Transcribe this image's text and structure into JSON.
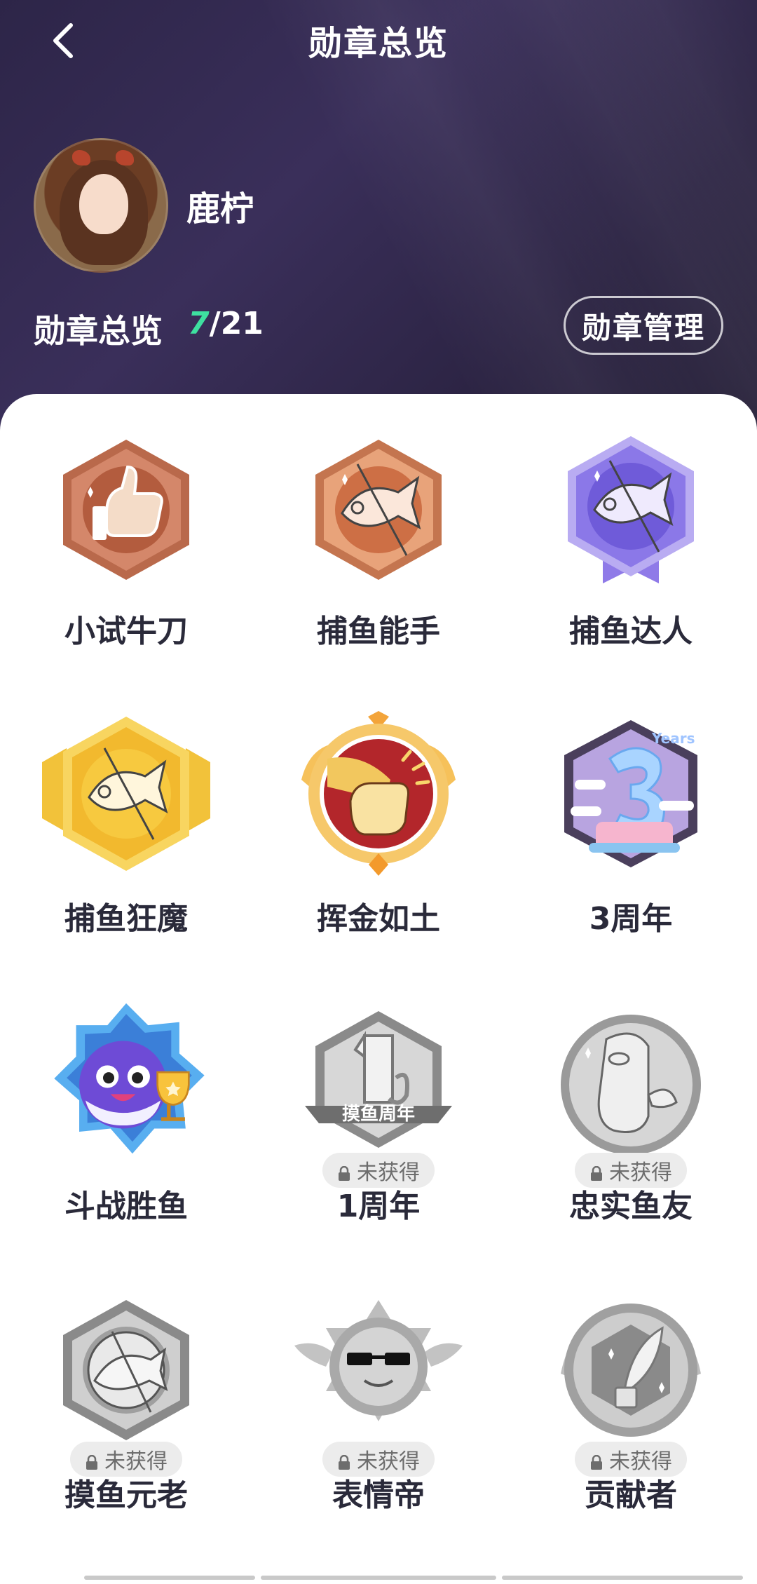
{
  "header": {
    "title": "勋章总览",
    "username": "鹿柠",
    "summary_label": "勋章总览",
    "earned": "7",
    "total_text": "/21",
    "manage_button": "勋章管理"
  },
  "badges": [
    {
      "name": "小试牛刀",
      "icon": "thumbs-up-bronze-hexagon",
      "earned": true
    },
    {
      "name": "捕鱼能手",
      "icon": "fish-copper-hexagon",
      "earned": true
    },
    {
      "name": "捕鱼达人",
      "icon": "fish-purple-hexagon",
      "earned": true
    },
    {
      "name": "捕鱼狂魔",
      "icon": "fish-gold-hexagon",
      "earned": true
    },
    {
      "name": "挥金如土",
      "icon": "hand-gold-medal",
      "earned": true
    },
    {
      "name": "3周年",
      "icon": "three-years-cake",
      "earned": true
    },
    {
      "name": "斗战胜鱼",
      "icon": "pufferfish-trophy",
      "earned": true
    },
    {
      "name": "1周年",
      "icon": "one-year-grey",
      "earned": false,
      "text": "摸鱼周年"
    },
    {
      "name": "忠实鱼友",
      "icon": "fish-grey-circle",
      "earned": false
    },
    {
      "name": "摸鱼元老",
      "icon": "fish-grey-hexagon",
      "earned": false
    },
    {
      "name": "表情帝",
      "icon": "sunglasses-grey-star",
      "earned": false
    },
    {
      "name": "贡献者",
      "icon": "feather-grey-circle",
      "earned": false
    }
  ],
  "locked_label": "未获得",
  "colors": {
    "header_bg": "#2d2548",
    "earned_count": "#3ee0a0",
    "panel_bg": "#ffffff",
    "badge_text": "#2a2a3a"
  }
}
